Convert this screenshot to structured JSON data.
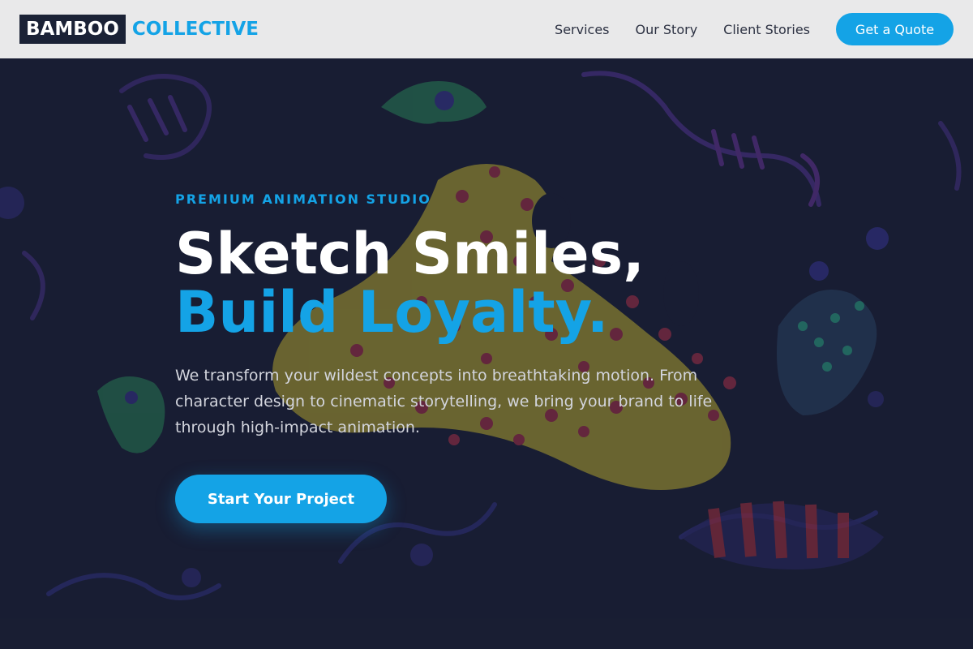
{
  "nav": {
    "logo_box": "BAMBOO",
    "logo_text": "COLLECTIVE",
    "links": [
      "Services",
      "Our Story",
      "Client Stories"
    ],
    "cta_label": "Get a Quote"
  },
  "hero": {
    "eyebrow": "PREMIUM ANIMATION STUDIO",
    "headline_line1": "Sketch Smiles,",
    "headline_line2": "Build Loyalty.",
    "subtext": "We transform your wildest concepts into breathtaking motion. From character design to cinematic storytelling, we bring your brand to life through high-impact animation.",
    "cta_label": "Start Your Project"
  },
  "colors": {
    "accent": "#14a3e6",
    "dark_bg": "#1a1f35",
    "nav_bg": "#e9e9ea"
  }
}
